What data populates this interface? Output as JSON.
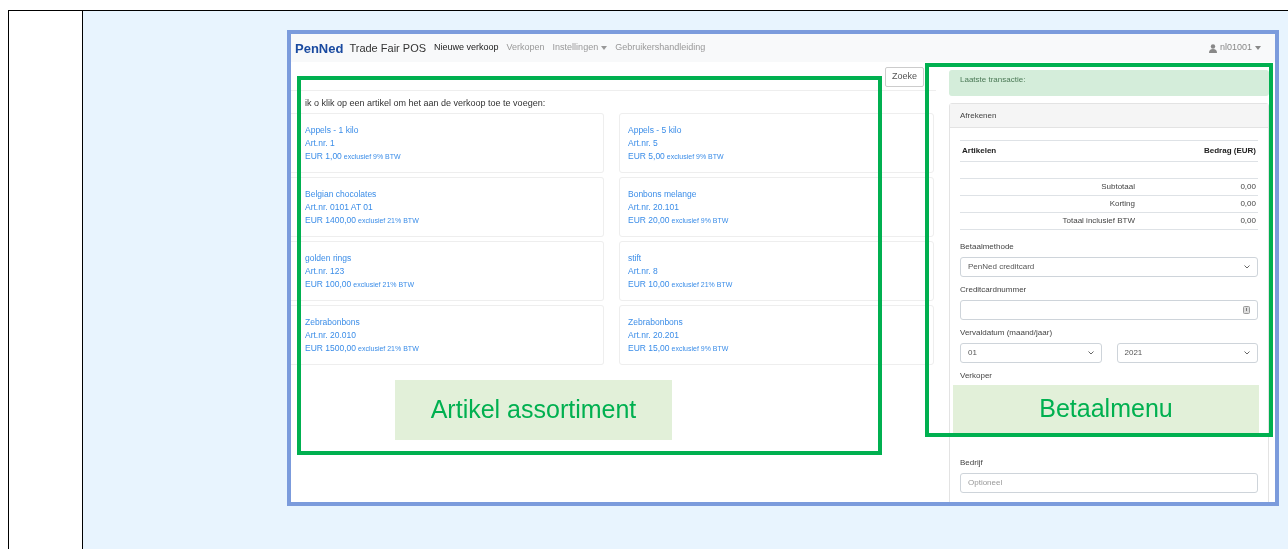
{
  "app": {
    "logo": "PenNed",
    "brand": "Trade Fair POS",
    "nav": [
      {
        "label": "Nieuwe verkoop",
        "selected": true,
        "dropdown": false
      },
      {
        "label": "Verkopen",
        "selected": false,
        "dropdown": false
      },
      {
        "label": "Instellingen",
        "selected": false,
        "dropdown": true
      },
      {
        "label": "Gebruikershandleiding",
        "selected": false,
        "dropdown": false
      }
    ],
    "user": "nl01001"
  },
  "search_button": "Zoeke",
  "instruction": "ik o klik op een artikel om het aan de verkoop toe te voegen:",
  "articles": [
    {
      "name": "Appels - 1 kilo",
      "number": "Art.nr. 1",
      "price": "EUR 1,00",
      "tax": "exclusief 9% BTW"
    },
    {
      "name": "Appels - 5 kilo",
      "number": "Art.nr. 5",
      "price": "EUR 5,00",
      "tax": "exclusief 9% BTW"
    },
    {
      "name": "Belgian chocolates",
      "number": "Art.nr. 0101 AT 01",
      "price": "EUR 1400,00",
      "tax": "exclusief 21% BTW"
    },
    {
      "name": "Bonbons melange",
      "number": "Art.nr. 20.101",
      "price": "EUR 20,00",
      "tax": "exclusief 9% BTW"
    },
    {
      "name": "golden rings",
      "number": "Art.nr. 123",
      "price": "EUR 100,00",
      "tax": "exclusief 21% BTW"
    },
    {
      "name": "stift",
      "number": "Art.nr. 8",
      "price": "EUR 10,00",
      "tax": "exclusief 21% BTW"
    },
    {
      "name": "Zebrabonbons",
      "number": "Art.nr. 20.010",
      "price": "EUR 1500,00",
      "tax": "exclusief 21% BTW"
    },
    {
      "name": "Zebrabonbons",
      "number": "Art.nr. 20.201",
      "price": "EUR 15,00",
      "tax": "exclusief 9% BTW"
    }
  ],
  "payment": {
    "last_transaction": "Laatste transactie:",
    "card_title": "Afrekenen",
    "columns": [
      "Artikelen",
      "Bedrag (EUR)"
    ],
    "totals": [
      {
        "label": "Subtotaal",
        "value": "0,00"
      },
      {
        "label": "Korting",
        "value": "0,00"
      },
      {
        "label": "Totaal inclusief BTW",
        "value": "0,00"
      }
    ],
    "fields": [
      {
        "kind": "select",
        "label": "Betaalmethode",
        "values": [
          "PenNed creditcard"
        ]
      },
      {
        "kind": "input",
        "label": "Creditcardnummer",
        "icon": true
      },
      {
        "kind": "select",
        "label": "Vervaldatum (maand/jaar)",
        "values": [
          "01",
          "2021"
        ]
      },
      {
        "kind": "covered",
        "label": "Verkoper"
      },
      {
        "kind": "input",
        "label": "Bedrijf",
        "placeholder": "Optioneel",
        "icon": false
      }
    ]
  },
  "annotations": [
    {
      "label": "Artikel assortiment"
    },
    {
      "label": "Betaalmenu"
    }
  ]
}
